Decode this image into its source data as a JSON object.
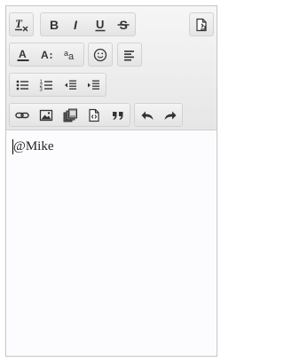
{
  "editor": {
    "body_text": "@Mike"
  },
  "toolbar": {
    "groups": [
      {
        "name": "remove-format-group",
        "icons": [
          "remove-format-icon"
        ]
      },
      {
        "name": "basic-styles-group",
        "icons": [
          "bold-icon",
          "italic-icon",
          "underline-icon",
          "strikethrough-icon"
        ]
      },
      {
        "name": "source-group",
        "icons": [
          "source-document-icon"
        ]
      },
      {
        "name": "text-style-group",
        "icons": [
          "text-color-icon",
          "font-size-icon",
          "format-icon"
        ]
      },
      {
        "name": "emoji-group",
        "icons": [
          "smiley-icon"
        ]
      },
      {
        "name": "align-group",
        "icons": [
          "align-left-icon"
        ]
      },
      {
        "name": "list-group",
        "icons": [
          "bulleted-list-icon",
          "numbered-list-icon",
          "decrease-indent-icon",
          "increase-indent-icon"
        ]
      },
      {
        "name": "insert-group",
        "icons": [
          "link-icon",
          "image-icon",
          "media-icon",
          "document-template-icon",
          "blockquote-icon"
        ]
      },
      {
        "name": "history-group",
        "icons": [
          "undo-icon",
          "redo-icon"
        ]
      }
    ]
  },
  "colors": {
    "toolbar_bg": "#ececec",
    "content_bg": "#fcfcfe",
    "border": "#c5c5c5",
    "icon": "#333333"
  }
}
